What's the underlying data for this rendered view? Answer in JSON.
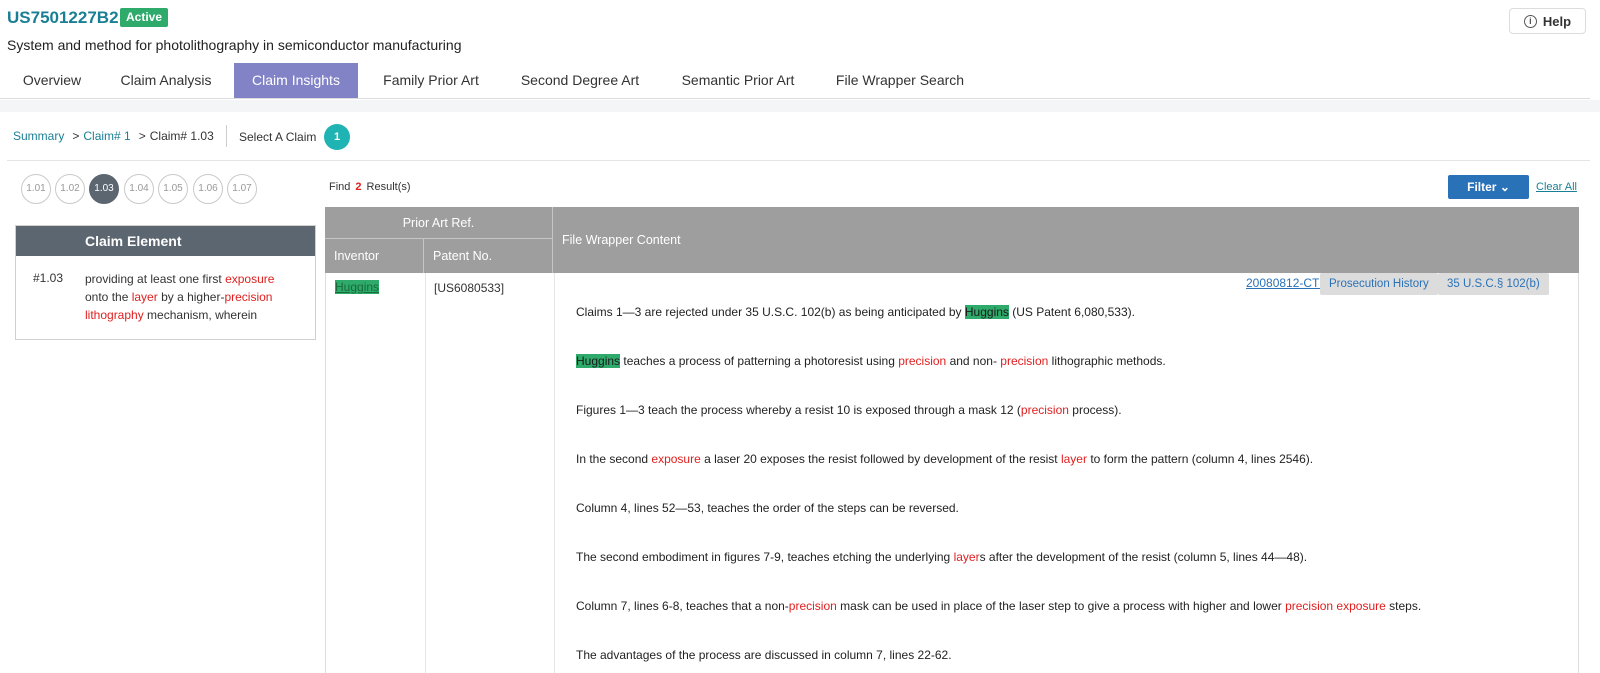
{
  "header": {
    "patent_id": "US7501227B2",
    "status": "Active",
    "title": "System and method for photolithography in semiconductor manufacturing",
    "help_label": "Help",
    "help_icon": "info-icon"
  },
  "tabs": [
    {
      "label": "Overview",
      "active": false
    },
    {
      "label": "Claim Analysis",
      "active": false
    },
    {
      "label": "Claim Insights",
      "active": true
    },
    {
      "label": "Family Prior Art",
      "active": false
    },
    {
      "label": "Second Degree Art",
      "active": false
    },
    {
      "label": "Semantic Prior Art",
      "active": false
    },
    {
      "label": "File Wrapper Search",
      "active": false
    }
  ],
  "breadcrumb": {
    "summary": "Summary",
    "claim": "Claim# 1",
    "current": "Claim# 1.03",
    "sep": ">",
    "select_label": "Select A Claim",
    "selected_claim": "1"
  },
  "claim_pills": [
    "1.01",
    "1.02",
    "1.03",
    "1.04",
    "1.05",
    "1.06",
    "1.07"
  ],
  "claim_element": {
    "header": "Claim Element",
    "number": "#1.03",
    "text_parts": [
      {
        "t": "providing at least one first ",
        "h": ""
      },
      {
        "t": "exposure",
        "h": "red"
      },
      {
        "t": " onto the ",
        "h": ""
      },
      {
        "t": "layer",
        "h": "red"
      },
      {
        "t": " by a higher-",
        "h": ""
      },
      {
        "t": "precision lithography",
        "h": "red"
      },
      {
        "t": " mechanism, wherein",
        "h": ""
      }
    ]
  },
  "results": {
    "find": "Find",
    "count": "2",
    "suffix": "Result(s)"
  },
  "filter": {
    "label": "Filter",
    "clear_all": "Clear All"
  },
  "table": {
    "prior_art_ref": "Prior Art Ref.",
    "inventor_col": "Inventor",
    "patent_col": "Patent No.",
    "content_col": "File Wrapper Content",
    "row": {
      "inventor": "Huggins",
      "patent": "[US6080533]",
      "doc_link": "20080812-CTNF",
      "tags": [
        "Prosecution History",
        "35 U.S.C.§ 102(b)"
      ],
      "paragraphs": [
        [
          {
            "t": "Claims 1—3 are rejected under 35 U.S.C. 102(b) as being anticipated by ",
            "h": ""
          },
          {
            "t": "Huggins",
            "h": "green"
          },
          {
            "t": " (US Patent 6,080,533).",
            "h": ""
          }
        ],
        [
          {
            "t": "Huggins",
            "h": "green"
          },
          {
            "t": " teaches a process of patterning a photoresist using ",
            "h": ""
          },
          {
            "t": "precision",
            "h": "red"
          },
          {
            "t": " and non- ",
            "h": ""
          },
          {
            "t": "precision",
            "h": "red"
          },
          {
            "t": " lithographic methods.",
            "h": ""
          }
        ],
        [
          {
            "t": "Figures 1—3 teach the process whereby a resist 10 is exposed through a mask 12 (",
            "h": ""
          },
          {
            "t": "precision",
            "h": "red"
          },
          {
            "t": " process).",
            "h": ""
          }
        ],
        [
          {
            "t": "In the second ",
            "h": ""
          },
          {
            "t": "exposure",
            "h": "red"
          },
          {
            "t": " a laser 20 exposes the resist followed by development of the resist ",
            "h": ""
          },
          {
            "t": "layer",
            "h": "red"
          },
          {
            "t": " to form the pattern (column 4, lines 2546).",
            "h": ""
          }
        ],
        [
          {
            "t": "Column 4, lines 52—53, teaches the order of the steps can be reversed.",
            "h": ""
          }
        ],
        [
          {
            "t": "The second embodiment in figures 7-9, teaches etching the underlying ",
            "h": ""
          },
          {
            "t": "layer",
            "h": "red"
          },
          {
            "t": "s after the development of the resist (column 5, lines 44—48).",
            "h": ""
          }
        ],
        [
          {
            "t": "Column 7, lines 6-8, teaches that a non-",
            "h": ""
          },
          {
            "t": "precision",
            "h": "red"
          },
          {
            "t": " mask can be used in place of the laser step to give a process with higher and lower ",
            "h": ""
          },
          {
            "t": "precision exposure",
            "h": "red"
          },
          {
            "t": " steps.",
            "h": ""
          }
        ],
        [
          {
            "t": "The advantages of the process are discussed in column 7, lines 22-62.",
            "h": ""
          }
        ]
      ]
    }
  },
  "colors": {
    "brand": "#1a7f95",
    "active_tab": "#8282c6",
    "badge": "#2eaa6b",
    "highlight_red": "#e02020",
    "highlight_green": "#2eaa6b",
    "filter_button": "#2a72b8",
    "table_header": "#9e9e9e"
  }
}
